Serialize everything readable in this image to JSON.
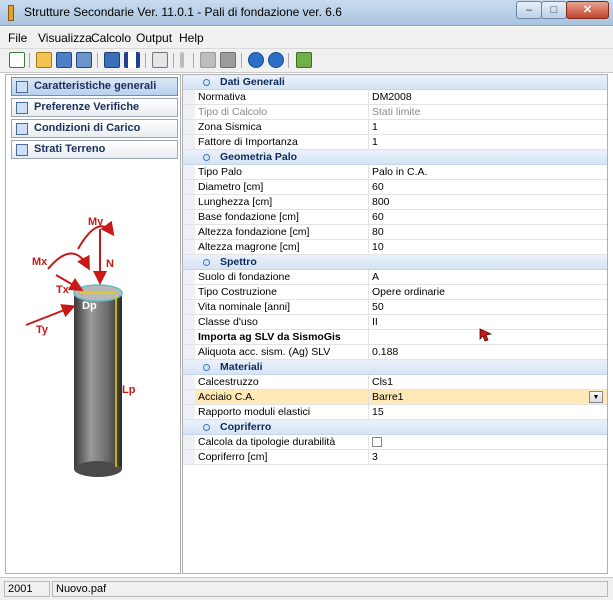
{
  "window": {
    "title": "Strutture Secondarie Ver. 11.0.1 - Pali di fondazione ver. 6.6",
    "controls": {
      "minimize": "–",
      "maximize": "□",
      "close": "✕"
    }
  },
  "menu": [
    "File",
    "Visualizza",
    "Calcolo",
    "Output",
    "Help"
  ],
  "toolbar_icons": [
    "new-file-icon",
    "open-folder-icon",
    "save-icon",
    "save-all-icon",
    "cube-icon",
    "i-beam-icon",
    "calculator-icon",
    "text-cursor-icon",
    "blank-icon",
    "print-icon",
    "help-icon",
    "info-icon",
    "exit-icon"
  ],
  "nav": [
    {
      "label": "Caratteristiche generali",
      "icon": "grid-icon",
      "active": true
    },
    {
      "label": "Preferenze Verifiche",
      "icon": "settings-icon",
      "active": false
    },
    {
      "label": "Condizioni di Carico",
      "icon": "load-icon",
      "active": false
    },
    {
      "label": "Strati Terreno",
      "icon": "layers-icon",
      "active": false
    }
  ],
  "figure": {
    "labels": {
      "my": "My",
      "mx": "Mx",
      "n": "N",
      "tx": "Tx",
      "ty": "Ty",
      "dp": "Dp",
      "lp": "Lp"
    }
  },
  "grid": {
    "dati_generali": {
      "title": "Dati Generali",
      "rows": [
        {
          "key": "Normativa",
          "value": "DM2008"
        },
        {
          "key": "Tipo di Calcolo",
          "value": "Stati limite"
        },
        {
          "key": "Zona Sismica",
          "value": "1"
        },
        {
          "key": "Fattore di Importanza",
          "value": "1"
        }
      ]
    },
    "geometria_palo": {
      "title": "Geometria Palo",
      "rows": [
        {
          "key": "Tipo Palo",
          "value": "Palo in C.A."
        },
        {
          "key": "Diametro [cm]",
          "value": "60"
        },
        {
          "key": "Lunghezza [cm]",
          "value": "800"
        },
        {
          "key": "Base fondazione [cm]",
          "value": "60"
        },
        {
          "key": "Altezza fondazione [cm]",
          "value": "80"
        },
        {
          "key": "Altezza magrone [cm]",
          "value": "10"
        }
      ]
    },
    "spettro": {
      "title": "Spettro",
      "rows": [
        {
          "key": "Suolo di fondazione",
          "value": "A"
        },
        {
          "key": "Tipo Costruzione",
          "value": "Opere ordinarie"
        },
        {
          "key": "Vita nominale [anni]",
          "value": "50"
        },
        {
          "key": "Classe d'uso",
          "value": "II"
        },
        {
          "key": "Importa ag SLV da SismoGis",
          "value": ""
        },
        {
          "key": "Aliquota acc. sism. (Ag) SLV",
          "value": "0.188"
        }
      ]
    },
    "materiali": {
      "title": "Materiali",
      "rows": [
        {
          "key": "Calcestruzzo",
          "value": "Cls1"
        },
        {
          "key": "Acciaio C.A.",
          "value": "Barre1"
        },
        {
          "key": "Rapporto moduli elastici",
          "value": "15"
        }
      ]
    },
    "copriferro": {
      "title": "Copriferro",
      "rows": [
        {
          "key": "Calcola da tipologie durabilità",
          "value": ""
        },
        {
          "key": "Copriferro [cm]",
          "value": "3"
        }
      ]
    }
  },
  "status": {
    "code": "2001",
    "file": "Nuovo.paf"
  },
  "colors": {
    "accent": "#3b77c5",
    "selected_row": "#ffe9b6",
    "category_text": "#0b2a5a"
  }
}
